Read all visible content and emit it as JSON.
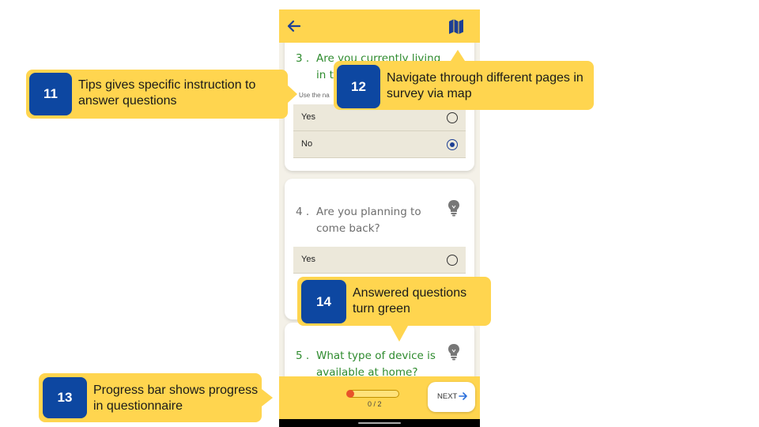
{
  "app": {
    "colors": {
      "appbar": "#ffd54f",
      "accent": "#0d47a1",
      "answered": "#2e8b2e",
      "progress_dot": "#e8532a"
    },
    "header": {
      "back_icon": "back-arrow-icon",
      "map_icon": "map-icon"
    },
    "questions": [
      {
        "number": "3 .",
        "text": "Are you currently living in the",
        "state": "answered",
        "hint": "Use the na",
        "options": [
          {
            "label": "Yes",
            "selected": false
          },
          {
            "label": "No",
            "selected": true
          }
        ]
      },
      {
        "number": "4 .",
        "text": "Are you planning to come back?",
        "state": "unanswered",
        "tip_icon": "lightbulb-icon",
        "options": [
          {
            "label": "Yes",
            "selected": false
          }
        ]
      },
      {
        "number": "5 .",
        "text": "What type of device is available at home?",
        "state": "answered",
        "tip_icon": "lightbulb-icon"
      }
    ],
    "footer": {
      "progress_text": "0 / 2",
      "progress_fraction": 0,
      "next_label": "NEXT"
    }
  },
  "callouts": {
    "c11": {
      "badge": "11",
      "text": "Tips gives specific instruction to answer questions"
    },
    "c12": {
      "badge": "12",
      "text": "Navigate through different pages in survey via map"
    },
    "c13": {
      "badge": "13",
      "text": "Progress bar shows progress in questionnaire"
    },
    "c14": {
      "badge": "14",
      "text": "Answered questions turn green"
    }
  }
}
